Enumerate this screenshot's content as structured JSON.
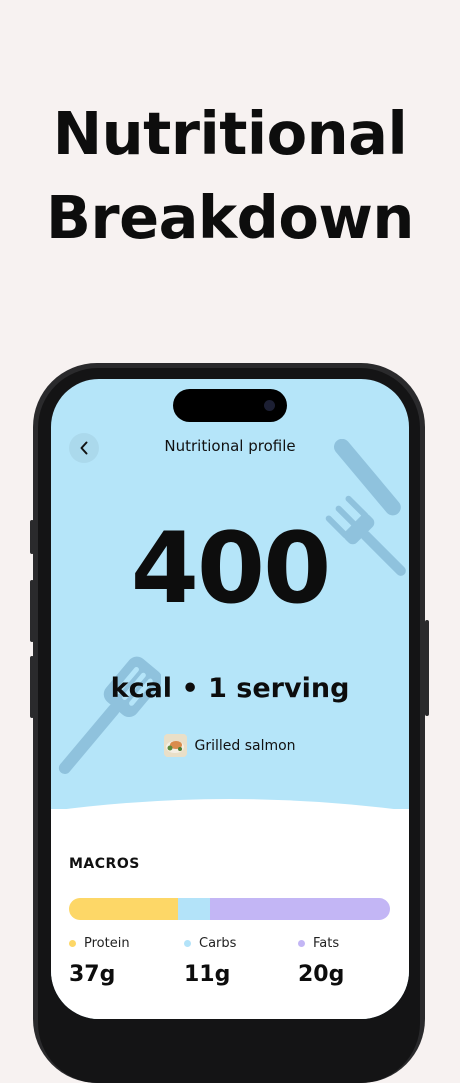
{
  "headline": {
    "line1": "Nutritional",
    "line2": "Breakdown"
  },
  "screen": {
    "nav_title": "Nutritional profile",
    "calories": "400",
    "calorie_label": "kcal • 1 serving",
    "food_name": "Grilled salmon",
    "macros": {
      "title": "MACROS",
      "items": [
        {
          "label": "Protein",
          "value": "37g",
          "color": "#fdd767",
          "fraction": 0.34
        },
        {
          "label": "Carbs",
          "value": "11g",
          "color": "#b3e3f9",
          "fraction": 0.1
        },
        {
          "label": "Fats",
          "value": "20g",
          "color": "#c3b6f5",
          "fraction": 0.56
        }
      ]
    }
  },
  "colors": {
    "page_bg": "#f7f2f1",
    "screen_bg": "#b5e5f9",
    "decor_icon": "#8fc2dd"
  }
}
